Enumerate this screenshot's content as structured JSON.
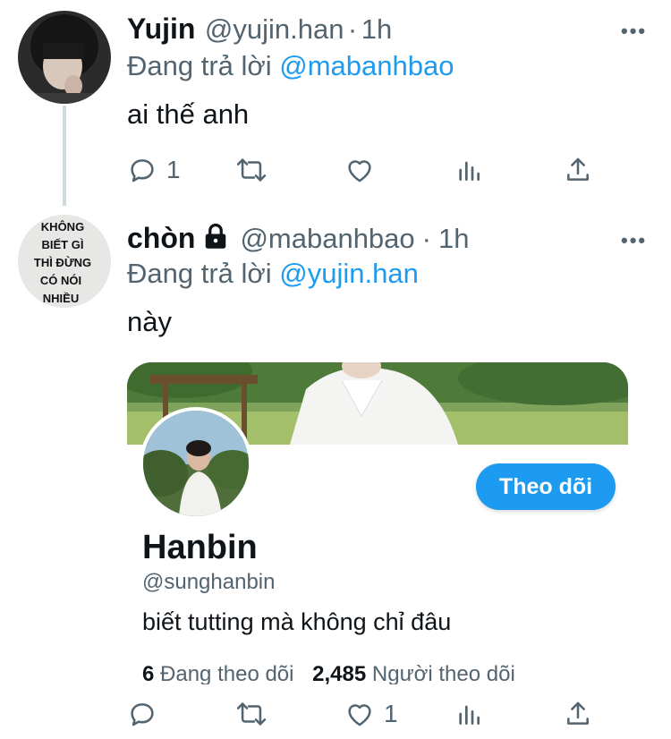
{
  "tweets": [
    {
      "name": "Yujin",
      "handle": "@yujin.han",
      "time": "1h",
      "separator": "·",
      "replying_prefix": "Đang trả lời",
      "replying_to": "@mabanhbao",
      "text": "ai thế anh",
      "reply_count": "1",
      "like_count": ""
    },
    {
      "name": "chòn",
      "handle": "@mabanhbao",
      "time": "1h",
      "separator": "·",
      "replying_prefix": "Đang trả lời",
      "replying_to": "@yujin.han",
      "text": "này",
      "reply_count": "",
      "like_count": "1",
      "avatar_text": [
        "KHÔNG",
        "BIẾT GÌ",
        "THÌ ĐỪNG",
        "CÓ NÓI",
        "NHIỀU"
      ]
    }
  ],
  "card": {
    "name": "Hanbin",
    "handle": "@sunghanbin",
    "bio": "biết tutting mà không chỉ đâu",
    "follow_label": "Theo dõi",
    "following_count": "6",
    "following_label": "Đang theo dõi",
    "followers_count": "2,485",
    "followers_label": "Người theo dõi"
  },
  "icons": [
    "more-icon",
    "reply-icon",
    "retweet-icon",
    "like-icon",
    "analytics-icon",
    "share-icon",
    "lock-icon"
  ],
  "colors": {
    "accent": "#1d9bf0",
    "secondary_text": "#536471",
    "primary_text": "#0f1419"
  }
}
